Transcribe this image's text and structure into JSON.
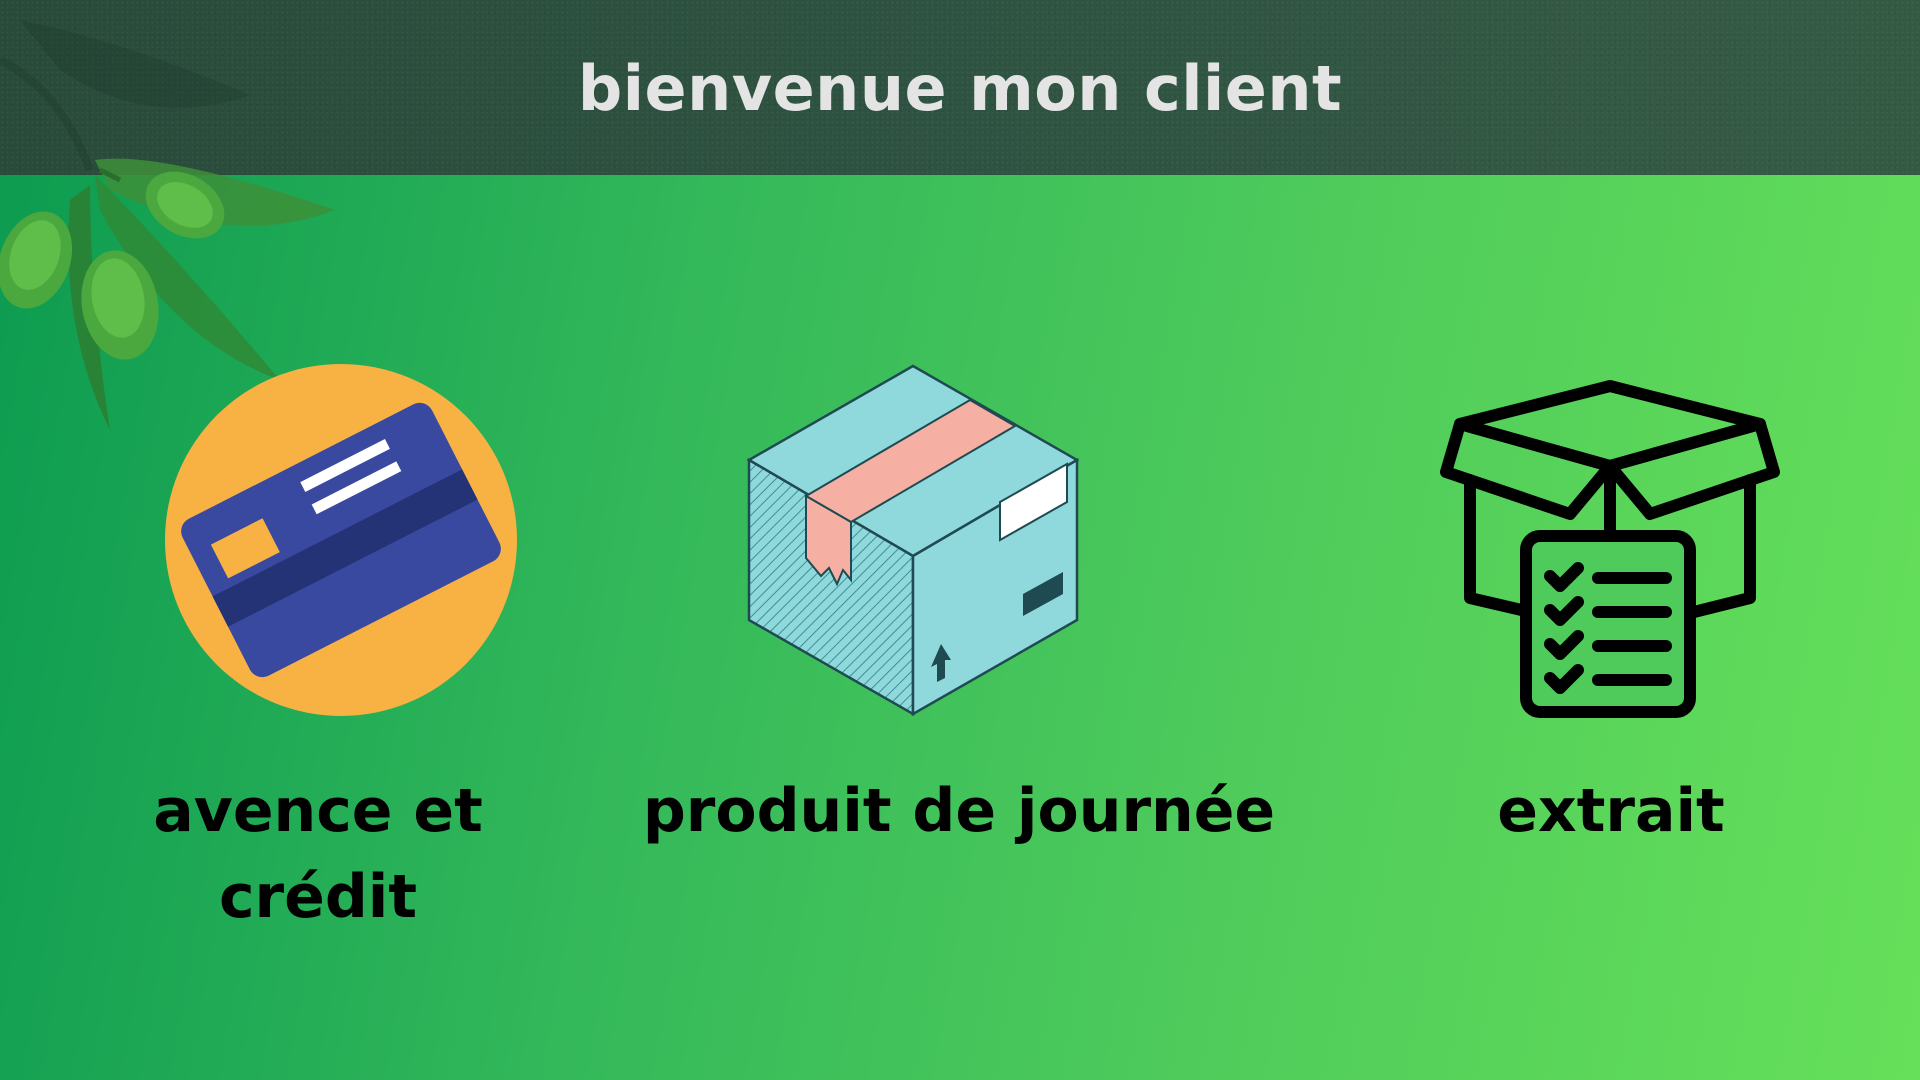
{
  "header": {
    "title": "bienvenue mon client"
  },
  "menu": {
    "items": [
      {
        "label_lines": [
          "avence et",
          "crédit"
        ],
        "icon": "credit-card-icon"
      },
      {
        "label": "produit de journée",
        "icon": "cardboard-box-icon"
      },
      {
        "label": "extrait",
        "icon": "box-checklist-icon"
      }
    ]
  },
  "colors": {
    "header_bg": "#2f5342",
    "title_text": "#e4e4e4",
    "gradient_left": "#0b9a50",
    "gradient_right": "#66e05a",
    "card_circle": "#f8b244",
    "card_body": "#3949a0",
    "box_face": "#8fd9dc",
    "box_tape": "#f5b0a3"
  }
}
